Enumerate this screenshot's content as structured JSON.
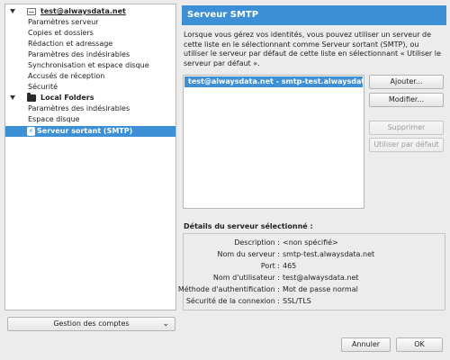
{
  "tree": {
    "account": {
      "name": "test@alwaysdata.net",
      "items": [
        "Paramètres serveur",
        "Copies et dossiers",
        "Rédaction et adressage",
        "Paramètres des indésirables",
        "Synchronisation et espace disque",
        "Accusés de réception",
        "Sécurité"
      ]
    },
    "local": {
      "name": "Local Folders",
      "items": [
        "Paramètres des indésirables",
        "Espace disque"
      ]
    },
    "smtp_label": "Serveur sortant (SMTP)"
  },
  "manage_accounts": {
    "label": "Gestion des comptes",
    "chevron": "⌄"
  },
  "header": {
    "title": "Serveur SMTP"
  },
  "description": "Lorsque vous gérez vos identités, vous pouvez utiliser un serveur de cette liste en le sélectionnant comme Serveur sortant (SMTP), ou utiliser le serveur par défaut de cette liste en sélectionnant « Utiliser le serveur par défaut ».",
  "servers": [
    "test@alwaysdata.net - smtp-test.alwaysdata.net (Par défaut)"
  ],
  "buttons": {
    "add": "Ajouter...",
    "modify": "Modifier...",
    "delete": "Supprimer",
    "set_default": "Utiliser par défaut"
  },
  "details": {
    "title": "Détails du serveur sélectionné :",
    "rows": [
      {
        "key": "Description :",
        "value": "<non spécifié>"
      },
      {
        "key": "Nom du serveur :",
        "value": "smtp-test.alwaysdata.net"
      },
      {
        "key": "Port :",
        "value": "465"
      },
      {
        "key": "Nom d'utilisateur :",
        "value": "test@alwaysdata.net"
      },
      {
        "key": "Méthode d'authentification :",
        "value": "Mot de passe normal"
      },
      {
        "key": "Sécurité de la connexion :",
        "value": "SSL/TLS"
      }
    ]
  },
  "footer": {
    "cancel": "Annuler",
    "ok": "OK"
  },
  "colors": {
    "accent": "#3d8fd6"
  }
}
